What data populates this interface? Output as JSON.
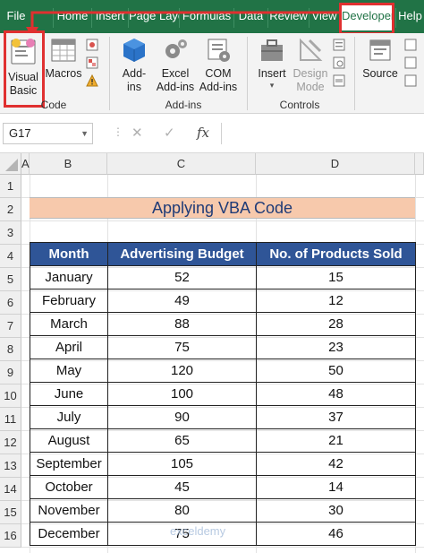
{
  "ribbon_tabs": [
    "File",
    "Home",
    "Insert",
    "Page Layout",
    "Formulas",
    "Data",
    "Review",
    "View",
    "Developer",
    "Help"
  ],
  "active_tab": "Developer",
  "ribbon": {
    "code_group": {
      "label": "Code",
      "visual_basic": "Visual\nBasic",
      "macros": "Macros"
    },
    "addins_group": {
      "label": "Add-ins",
      "addins": "Add-\nins",
      "excel_addins": "Excel\nAdd-ins",
      "com_addins": "COM\nAdd-ins"
    },
    "controls_group": {
      "label": "Controls",
      "insert": "Insert",
      "design_mode": "Design\nMode"
    },
    "xml_group": {
      "source": "Source"
    }
  },
  "formula_bar": {
    "name_box": "G17",
    "cancel": "✕",
    "enter": "✓",
    "fx": "fx",
    "value": ""
  },
  "column_headers": [
    "A",
    "B",
    "C",
    "D"
  ],
  "row_numbers": [
    "1",
    "2",
    "3",
    "4",
    "5",
    "6",
    "7",
    "8",
    "9",
    "10",
    "11",
    "12",
    "13",
    "14",
    "15",
    "16"
  ],
  "sheet": {
    "title": "Applying VBA Code",
    "headers": [
      "Month",
      "Advertising Budget",
      "No. of Products Sold"
    ],
    "rows": [
      [
        "January",
        "52",
        "15"
      ],
      [
        "February",
        "49",
        "12"
      ],
      [
        "March",
        "88",
        "28"
      ],
      [
        "April",
        "75",
        "23"
      ],
      [
        "May",
        "120",
        "50"
      ],
      [
        "June",
        "100",
        "48"
      ],
      [
        "July",
        "90",
        "37"
      ],
      [
        "August",
        "65",
        "21"
      ],
      [
        "September",
        "105",
        "42"
      ],
      [
        "October",
        "45",
        "14"
      ],
      [
        "November",
        "80",
        "30"
      ],
      [
        "December",
        "75",
        "46"
      ]
    ]
  },
  "watermark": "exceldemy",
  "colors": {
    "ribbon_green": "#217346",
    "title_fill": "#f7c9ac",
    "header_fill": "#2f5597",
    "highlight_red": "#e03030"
  }
}
